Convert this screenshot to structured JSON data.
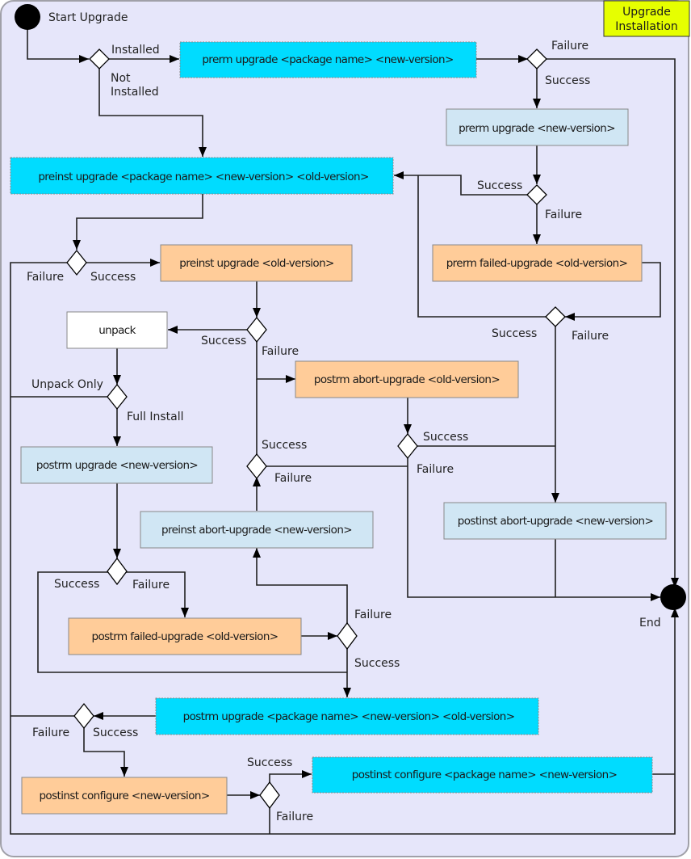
{
  "diagram": {
    "title": [
      "Upgrade",
      "Installation"
    ],
    "start_label": "Start Upgrade",
    "end_label": "End",
    "colors": {
      "background": "#e6e6fa",
      "maintainer_script": "#00dcff",
      "error_recovery": "#ffcc99",
      "normal_step": "#d0e6f4",
      "plain_step": "#ffffff",
      "title_box": "#e6ff00",
      "decision": "#ffffff",
      "terminal": "#000000"
    },
    "nodes": {
      "prerm_upgrade_pkg": "prerm upgrade <package name> <new-version>",
      "prerm_upgrade_new": "prerm upgrade <new-version>",
      "preinst_upgrade_pkg": "preinst upgrade <package name> <new-version> <old-version>",
      "preinst_upgrade_old": "preinst upgrade <old-version>",
      "prerm_failed_upgrade": "prerm failed-upgrade <old-version>",
      "unpack": "unpack",
      "postrm_abort_upgrade": "postrm abort-upgrade <old-version>",
      "postrm_upgrade_new": "postrm upgrade <new-version>",
      "preinst_abort_upgrade": "preinst abort-upgrade <new-version>",
      "postinst_abort_upgrade": "postinst abort-upgrade <new-version>",
      "postrm_failed_upgrade": "postrm failed-upgrade <old-version>",
      "postrm_upgrade_pkg": "postrm upgrade <package name> <new-version> <old-version>",
      "postinst_configure_new": "postinst configure <new-version>",
      "postinst_configure_pkg": "postinst configure <package name> <new-version>"
    },
    "labels": {
      "installed": "Installed",
      "not_installed": [
        "Not",
        "Installed"
      ],
      "success": "Success",
      "failure": "Failure",
      "unpack_only": "Unpack Only",
      "full_install": "Full Install"
    }
  }
}
